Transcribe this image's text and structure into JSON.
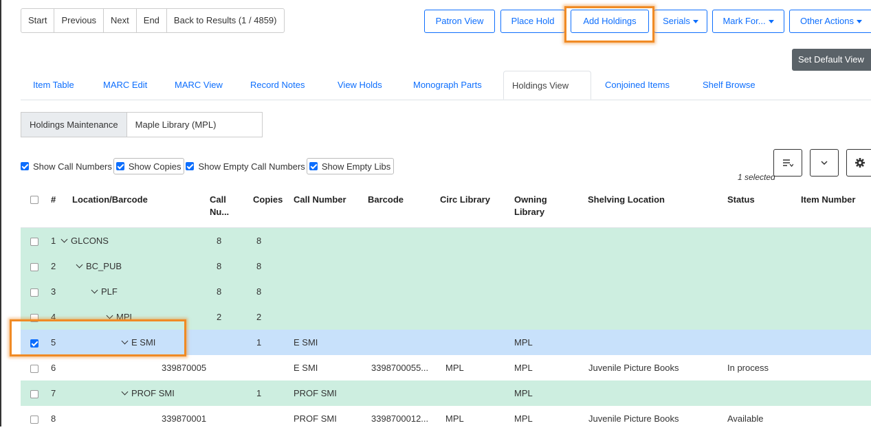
{
  "nav": {
    "start": "Start",
    "previous": "Previous",
    "next": "Next",
    "end": "End",
    "back": "Back to Results (1 / 4859)"
  },
  "actions": {
    "patron_view": "Patron View",
    "place_hold": "Place Hold",
    "add_holdings": "Add Holdings",
    "serials": "Serials",
    "mark_for": "Mark For...",
    "other_actions": "Other Actions"
  },
  "set_default_view": "Set Default View",
  "tabs": [
    "Item Table",
    "MARC Edit",
    "MARC View",
    "Record Notes",
    "View Holds",
    "Monograph Parts",
    "Holdings View",
    "Conjoined Items",
    "Shelf Browse"
  ],
  "subtabs": {
    "maintenance": "Holdings Maintenance",
    "library": "Maple Library (MPL)"
  },
  "filters": [
    "Show Call Numbers",
    "Show Copies",
    "Show Empty Call Numbers",
    "Show Empty Libs"
  ],
  "selected_count": "1 selected",
  "columns": {
    "num": "#",
    "location": "Location/Barcode",
    "callnum_a": "Call",
    "callnum_b": "Nu...",
    "copies": "Copies",
    "call_number": "Call Number",
    "barcode": "Barcode",
    "circ_library": "Circ Library",
    "owning_a": "Owning",
    "owning_b": "Library",
    "shelving": "Shelving Location",
    "status": "Status",
    "item_number": "Item Number"
  },
  "rows": [
    {
      "num": "1",
      "loc": "GLCONS",
      "callnums": "8",
      "copies": "8",
      "call_number": "",
      "barcode": "",
      "circ": "",
      "owning": "",
      "shelving": "",
      "status": ""
    },
    {
      "num": "2",
      "loc": "BC_PUB",
      "callnums": "8",
      "copies": "8",
      "call_number": "",
      "barcode": "",
      "circ": "",
      "owning": "",
      "shelving": "",
      "status": ""
    },
    {
      "num": "3",
      "loc": "PLF",
      "callnums": "8",
      "copies": "8",
      "call_number": "",
      "barcode": "",
      "circ": "",
      "owning": "",
      "shelving": "",
      "status": ""
    },
    {
      "num": "4",
      "loc": "MPL",
      "callnums": "2",
      "copies": "2",
      "call_number": "",
      "barcode": "",
      "circ": "",
      "owning": "",
      "shelving": "",
      "status": ""
    },
    {
      "num": "5",
      "loc": "E SMI",
      "callnums": "",
      "copies": "1",
      "call_number": "E SMI",
      "barcode": "",
      "circ": "",
      "owning": "MPL",
      "shelving": "",
      "status": ""
    },
    {
      "num": "6",
      "loc": "339870005",
      "callnums": "",
      "copies": "",
      "call_number": "E SMI",
      "barcode": "3398700055...",
      "circ": "MPL",
      "owning": "MPL",
      "shelving": "Juvenile Picture Books",
      "status": "In process"
    },
    {
      "num": "7",
      "loc": "PROF SMI",
      "callnums": "",
      "copies": "1",
      "call_number": "PROF SMI",
      "barcode": "",
      "circ": "",
      "owning": "MPL",
      "shelving": "",
      "status": ""
    },
    {
      "num": "8",
      "loc": "339870001",
      "callnums": "",
      "copies": "",
      "call_number": "PROF SMI",
      "barcode": "3398700012...",
      "circ": "MPL",
      "owning": "MPL",
      "shelving": "Juvenile Picture Books",
      "status": "Available"
    }
  ],
  "colors": {
    "accent": "#0d6efd",
    "highlight": "#f08a24",
    "org_row": "#cdeee0",
    "selected_row": "#c8e1fb"
  }
}
